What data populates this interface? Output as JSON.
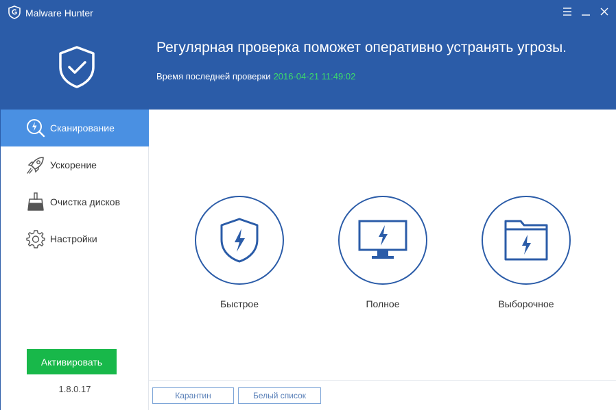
{
  "app": {
    "title": "Malware Hunter",
    "accent_color": "#2b5ca8",
    "active_color": "#4a90e2",
    "success_color": "#18b84a"
  },
  "header": {
    "headline": "Регулярная проверка поможет оперативно устранять угрозы.",
    "last_scan_label": "Время последней проверки",
    "last_scan_time": "2016-04-21 11:49:02"
  },
  "sidebar": {
    "items": [
      {
        "label": "Сканирование",
        "icon": "scan-icon",
        "active": true
      },
      {
        "label": "Ускорение",
        "icon": "rocket-icon",
        "active": false
      },
      {
        "label": "Очистка дисков",
        "icon": "broom-icon",
        "active": false
      },
      {
        "label": "Настройки",
        "icon": "gear-icon",
        "active": false
      }
    ],
    "activate_label": "Активировать",
    "version": "1.8.0.17"
  },
  "scan_options": [
    {
      "label": "Быстрое",
      "icon": "shield-bolt-icon"
    },
    {
      "label": "Полное",
      "icon": "monitor-bolt-icon"
    },
    {
      "label": "Выборочное",
      "icon": "folder-bolt-icon"
    }
  ],
  "footer": {
    "quarantine_label": "Карантин",
    "whitelist_label": "Белый список"
  }
}
